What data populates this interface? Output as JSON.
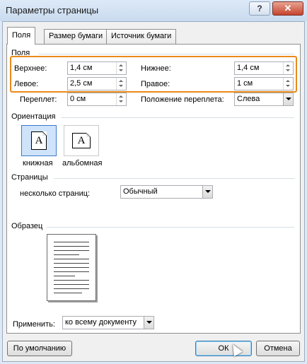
{
  "window": {
    "title": "Параметры страницы",
    "help_label": "?",
    "close_label": "✕"
  },
  "tabs": [
    {
      "label": "Поля",
      "active": true
    },
    {
      "label": "Размер бумаги",
      "active": false
    },
    {
      "label": "Источник бумаги",
      "active": false
    }
  ],
  "margins": {
    "group_label": "Поля",
    "top_label": "Верхнее:",
    "top_value": "1,4 см",
    "bottom_label": "Нижнее:",
    "bottom_value": "1,4 см",
    "left_label": "Левое:",
    "left_value": "2,5 см",
    "right_label": "Правое:",
    "right_value": "1 см",
    "gutter_label": "Переплет:",
    "gutter_value": "0 см",
    "gutter_pos_label": "Положение переплета:",
    "gutter_pos_value": "Слева",
    "highlight_color": "#e88a1a"
  },
  "orientation": {
    "group_label": "Ориентация",
    "portrait_label": "книжная",
    "landscape_label": "альбомная",
    "icon_letter": "A",
    "selected": "книжная"
  },
  "pages": {
    "group_label": "Страницы",
    "multiple_label": "несколько страниц:",
    "multiple_value": "Обычный"
  },
  "preview": {
    "group_label": "Образец"
  },
  "apply": {
    "label": "Применить:",
    "value": "ко всему документу"
  },
  "buttons": {
    "default_label": "По умолчанию",
    "ok_label": "ОК",
    "cancel_label": "Отмена"
  }
}
